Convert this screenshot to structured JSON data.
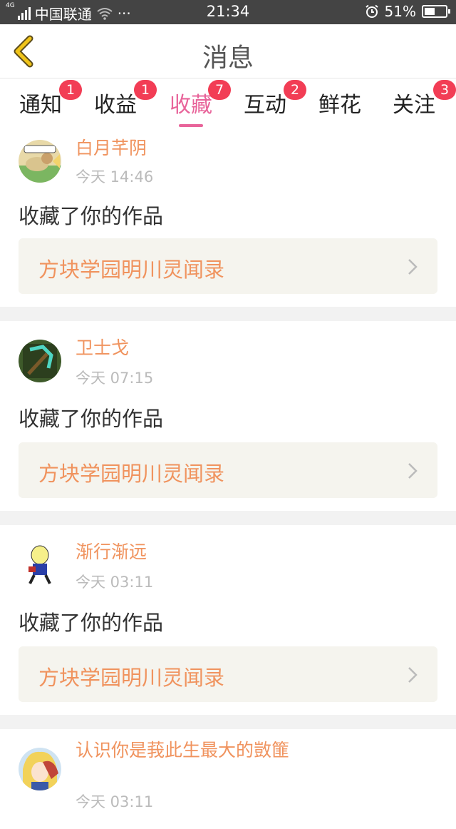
{
  "status_bar": {
    "network": "4G",
    "carrier": "中国联通",
    "wifi_icon": "wifi-icon",
    "more": "···",
    "time": "21:34",
    "alarm_icon": "alarm-icon",
    "battery_text": "51%",
    "battery_level": 0.51
  },
  "header": {
    "back_icon": "chevron-left-icon",
    "title": "消息"
  },
  "tabs": [
    {
      "label": "通知",
      "badge": "1"
    },
    {
      "label": "收益",
      "badge": "1"
    },
    {
      "label": "收藏",
      "badge": "7",
      "active": true
    },
    {
      "label": "互动",
      "badge": "2"
    },
    {
      "label": "鲜花",
      "badge": ""
    },
    {
      "label": "关注",
      "badge": "3"
    }
  ],
  "messages": [
    {
      "user": "白月芊阴",
      "time": "今天 14:46",
      "action": "收藏了你的作品",
      "work": "方块学园明川灵闻录"
    },
    {
      "user": "卫士戈",
      "time": "今天 07:15",
      "action": "收藏了你的作品",
      "work": "方块学园明川灵闻录"
    },
    {
      "user": "渐行渐远",
      "time": "今天 03:11",
      "action": "收藏了你的作品",
      "work": "方块学园明川灵闻录"
    },
    {
      "user": "认识你是莪此生最大的敳篚",
      "time": "今天 03:11",
      "action": "",
      "work": ""
    }
  ],
  "colors": {
    "accent_pink": "#e8649a",
    "name_orange": "#f0935e",
    "badge_red": "#f23d55",
    "back_yellow": "#f0c419"
  }
}
